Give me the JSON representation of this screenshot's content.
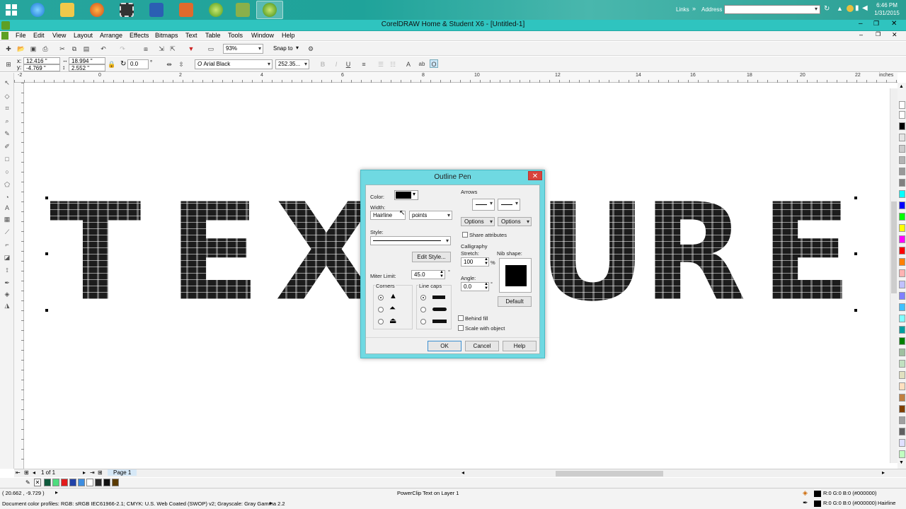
{
  "taskbar": {
    "links_label": "Links",
    "address_label": "Address",
    "clock_time": "6:46 PM",
    "clock_date": "1/31/2015"
  },
  "window": {
    "title": "CorelDRAW Home & Student X6 - [Untitled-1]"
  },
  "menu": [
    "File",
    "Edit",
    "View",
    "Layout",
    "Arrange",
    "Effects",
    "Bitmaps",
    "Text",
    "Table",
    "Tools",
    "Window",
    "Help"
  ],
  "toolbar": {
    "zoom": "93%",
    "snap_to": "Snap to"
  },
  "property_bar": {
    "x": "12.416 \"",
    "y": "-4.769 \"",
    "width": "18.994 \"",
    "height": "2.552 \"",
    "rotation": "0.0",
    "rotation_unit": "°",
    "font": "Arial Black",
    "font_size": "252.35..."
  },
  "ruler": {
    "unit": "inches",
    "ticks": [
      "-2",
      "0",
      "2",
      "4",
      "6",
      "8",
      "10",
      "12",
      "14",
      "16",
      "18",
      "20",
      "22"
    ]
  },
  "artwork": {
    "letters": [
      "T",
      "E",
      "X",
      "T",
      "U",
      "R",
      "E"
    ]
  },
  "page_nav": {
    "counter": "1 of 1",
    "page_tab": "Page 1"
  },
  "status": {
    "cursor_pos": "( 20.662 , -9.729 )",
    "object_info": "PowerClip Text on Layer 1",
    "color_profiles": "Document color profiles: RGB: sRGB IEC61966-2.1; CMYK: U.S. Web Coated (SWOP) v2; Grayscale: Gray Gamma 2.2",
    "fill_info": "R:0 G:0 B:0 (#000000)",
    "outline_info": "R:0 G:0 B:0 (#000000)",
    "outline_width": "Hairline"
  },
  "dialog": {
    "title": "Outline Pen",
    "color_label": "Color:",
    "width_label": "Width:",
    "width_value": "Hairline",
    "width_unit": "points",
    "style_label": "Style:",
    "edit_style_button": "Edit Style...",
    "miter_limit_label": "Miter Limit:",
    "miter_limit_value": "45.0",
    "corners_label": "Corners",
    "line_caps_label": "Line caps",
    "arrows_label": "Arrows",
    "options_left": "Options",
    "options_right": "Options",
    "share_attributes": "Share attributes",
    "calligraphy_label": "Calligraphy",
    "stretch_label": "Stretch:",
    "stretch_value": "100",
    "stretch_unit": "%",
    "nib_shape_label": "Nib shape:",
    "angle_label": "Angle:",
    "angle_value": "0.0",
    "angle_unit": "°",
    "default_button": "Default",
    "behind_fill": "Behind fill",
    "scale_with_object": "Scale with object",
    "ok_button": "OK",
    "cancel_button": "Cancel",
    "help_button": "Help"
  },
  "colors": {
    "accent": "#2fc4bf",
    "dialog_frame": "#6fd9e2",
    "text_fill": "#1c1c1c",
    "palette": [
      "#ffffff",
      "#000000",
      "#e5e5e5",
      "#cccccc",
      "#b3b3b3",
      "#999999",
      "#808080",
      "#00ffff",
      "#0000ff",
      "#00ff00",
      "#ffff00",
      "#ff00ff",
      "#ff0000",
      "#ff8000",
      "#ffb3b3",
      "#c0c0ff",
      "#8080ff",
      "#40c0ff",
      "#80ffff",
      "#00a0a0",
      "#008000",
      "#a0c0a0",
      "#c0e0c0",
      "#e0e0c0",
      "#ffe0c0",
      "#c08040",
      "#804000",
      "#a0a0a0",
      "#606060",
      "#e0e0ff",
      "#c0ffc0"
    ],
    "doc_palette": [
      "#0e5a3c",
      "#4fdc7e",
      "#e21b1b",
      "#2142a8",
      "#3d8de0",
      "#ffffff",
      "#2a2a2a",
      "#111111",
      "#5a3a00"
    ]
  }
}
